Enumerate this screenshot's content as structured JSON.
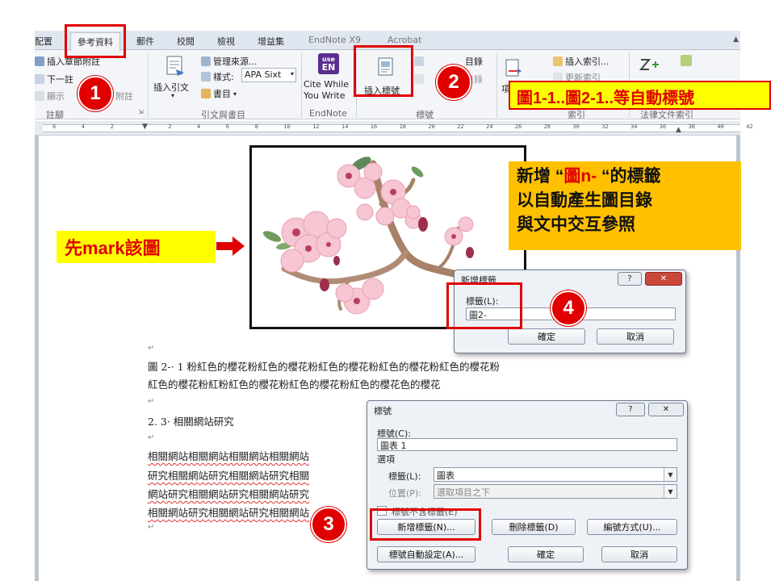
{
  "ribbon": {
    "tabs": [
      {
        "label": "配置",
        "active": false
      },
      {
        "label": "參考資料",
        "active": true
      },
      {
        "label": "郵件",
        "active": false
      },
      {
        "label": "校閱",
        "active": false
      },
      {
        "label": "檢視",
        "active": false
      },
      {
        "label": "增益集",
        "active": false
      },
      {
        "label": "EndNote X9",
        "active": false
      },
      {
        "label": "Acrobat",
        "active": false
      }
    ],
    "footnotes": {
      "insert_endnote": "插入章節附註",
      "next": "下一註",
      "show": "顯示",
      "show_tail": "附註",
      "group_label": "註腳"
    },
    "citations": {
      "insert_citation": "插入引文",
      "manage_sources": "管理來源...",
      "style_label": "樣式:",
      "style_value": "APA Sixt",
      "bibliography": "書目",
      "group_label": "引文與書目"
    },
    "endnote": {
      "cite_line1": "Cite While",
      "cite_line2": "You Write",
      "group_label": "EndNote",
      "icon_line1": "use",
      "icon_line2": "EN"
    },
    "captions": {
      "insert_caption": "插入標號",
      "table_of_figures_tail": "目錄",
      "update_tail": "目錄",
      "group_label": "標號"
    },
    "index": {
      "insert_index": "插入索引...",
      "update_index": "更新索引",
      "item": "項",
      "group_label": "索引"
    },
    "authorities": {
      "group_label": "法律文件索引"
    }
  },
  "ruler": {
    "numbers": [
      "6",
      "4",
      "2",
      "",
      "2",
      "4",
      "6",
      "8",
      "10",
      "12",
      "14",
      "16",
      "18",
      "20",
      "22",
      "24",
      "26",
      "28",
      "30",
      "32",
      "34",
      "36",
      "38",
      "40",
      "42"
    ]
  },
  "document": {
    "caption_line1": "圖 2-· 1 粉紅色的櫻花粉紅色的櫻花粉紅色的櫻花粉紅色的櫻花粉紅色的櫻花粉",
    "caption_line2": "紅色的櫻花粉紅粉紅色的櫻花粉紅色的櫻花粉紅色的櫻花色的櫻花",
    "heading": "2. 3· 相關網站研究",
    "para": [
      "相關網站相關網站相關網站相關網站",
      "研究相關網站研究相關網站研究相關",
      "網站研究相關網站研究相關網站研究",
      "相關網站研究相關網站研究相關網站"
    ]
  },
  "callouts": {
    "mark_figure": "先mark該圖",
    "auto_number": "圖1-1..圖2-1..等自動標號",
    "new_label_pre": "新增 “",
    "new_label_red": "圖n-",
    "new_label_post": " “的標籤",
    "line2": "以自動產生圖目錄",
    "line3": "與文中交互參照"
  },
  "badges": [
    "1",
    "2",
    "3",
    "4"
  ],
  "new_label_dialog": {
    "title": "新增標籤",
    "label": "標籤(L):",
    "value": "圖2-",
    "ok": "確定",
    "cancel": "取消",
    "help_icon": "?",
    "close_icon": "✕"
  },
  "caption_dialog": {
    "title": "標號",
    "caption_label": "標號(C):",
    "caption_value": "圖表 1",
    "options_label": "選項",
    "label_label": "標籤(L):",
    "label_value": "圖表",
    "position_label": "位置(P):",
    "position_value": "選取項目之下",
    "exclude_label": "標號不含標籤(E)",
    "new_label_btn": "新增標籤(N)...",
    "delete_label_btn": "刪除標籤(D)",
    "numbering_btn": "編號方式(U)...",
    "autocaption_btn": "標號自動設定(A)...",
    "ok": "確定",
    "cancel": "取消",
    "help_icon": "?",
    "close_icon": "✕"
  },
  "colors": {
    "highlight_red": "#e00000",
    "callout_yellow": "#ffff00",
    "callout_orange": "#ffc000"
  }
}
